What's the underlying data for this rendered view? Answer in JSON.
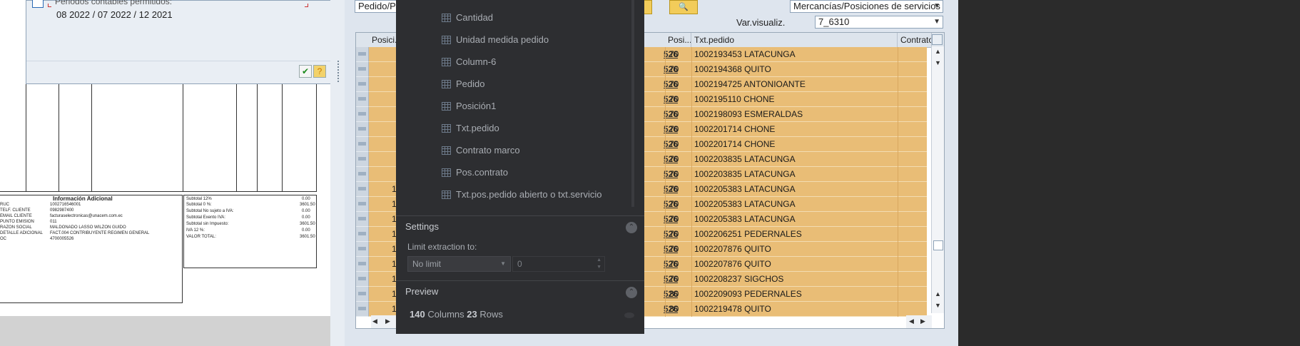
{
  "invoice": {
    "title": "Información Adicional",
    "rows": [
      {
        "label": "RUC",
        "value": "1002716546001"
      },
      {
        "label": "TELF. CLIENTE",
        "value": "0982987400"
      },
      {
        "label": "EMAIL CLIENTE",
        "value": "facturaselectronicas@unacem.com.ec"
      },
      {
        "label": "PUNTO EMISION",
        "value": "011"
      },
      {
        "label": "RAZON SOCIAL",
        "value": "MALDONADO LASSO WILZON GUIDO"
      },
      {
        "label": "DETALLE ADICIONAL",
        "value": "FACT.004 CONTRIBUYENTE REGIMEN GENERAL"
      },
      {
        "label": "OC",
        "value": "4700005526"
      }
    ],
    "totals": [
      {
        "label": "Subtotal 12%",
        "value": "0.00"
      },
      {
        "label": "Subtotal 0 %:",
        "value": "3601.50"
      },
      {
        "label": "Subtotal No sujeto a IVA:",
        "value": "0.00"
      },
      {
        "label": "Subtotal Exento IVA:",
        "value": "0.00"
      },
      {
        "label": "Subtotal sin Impuesto:",
        "value": "3601.50"
      },
      {
        "label": "IVA 12 %:",
        "value": "0.00"
      },
      {
        "label": "VALOR TOTAL:",
        "value": "3601.50"
      }
    ]
  },
  "dialog": {
    "top_text": "Periodos contables permitidos:",
    "periods": "08 2022 / 07 2022 / 12 2021"
  },
  "sap": {
    "combo_left": "Pedido/Pl",
    "combo_right": "Mercancías/Posiciones de servicios",
    "var_label": "Var.visualiz.",
    "var_value": "7_6310",
    "columns": [
      "Posici...",
      "Posi...",
      "Txt.pedido",
      "Contrato"
    ],
    "rows": [
      {
        "pos": "70",
        "txt": "1002193453 LATACUNGA"
      },
      {
        "pos": "70",
        "txt": "1002194368 QUITO"
      },
      {
        "pos": "70",
        "txt": "1002194725 ANTONIOANTE"
      },
      {
        "pos": "70",
        "txt": "1002195110 CHONE"
      },
      {
        "pos": "70",
        "txt": "1002198093 ESMERALDAS"
      },
      {
        "pos": "70",
        "txt": "1002201714 CHONE"
      },
      {
        "pos": "70",
        "txt": "1002201714 CHONE"
      },
      {
        "pos": "70",
        "txt": "1002203835 LATACUNGA"
      },
      {
        "pos": "70",
        "txt": "1002203835 LATACUNGA"
      },
      {
        "pos": "70",
        "txt": "1002205383 LATACUNGA"
      },
      {
        "pos": "70",
        "txt": "1002205383 LATACUNGA"
      },
      {
        "pos": "70",
        "txt": "1002205383 LATACUNGA"
      },
      {
        "pos": "70",
        "txt": "1002206251 PEDERNALES"
      },
      {
        "pos": "70",
        "txt": "1002207876 QUITO"
      },
      {
        "pos": "70",
        "txt": "1002207876 QUITO"
      },
      {
        "pos": "70",
        "txt": "1002208237 SIGCHOS"
      },
      {
        "pos": "80",
        "txt": "1002209093 PEDERNALES"
      },
      {
        "pos": "80",
        "txt": "1002219478 QUITO"
      }
    ],
    "col_526": "526",
    "left_digit": "1"
  },
  "panel": {
    "columns": [
      "Cantidad",
      "Unidad medida pedido",
      "Column-6",
      "Pedido",
      "Posición1",
      "Txt.pedido",
      "Contrato marco",
      "Pos.contrato",
      "Txt.pos.pedido abierto o txt.servicio"
    ],
    "settings_title": "Settings",
    "limit_label": "Limit extraction to:",
    "limit_value": "No limit",
    "limit_number": "0",
    "preview_title": "Preview",
    "preview_columns_count": "140",
    "preview_columns_label": "Columns",
    "preview_rows_count": "23",
    "preview_rows_label": "Rows"
  }
}
